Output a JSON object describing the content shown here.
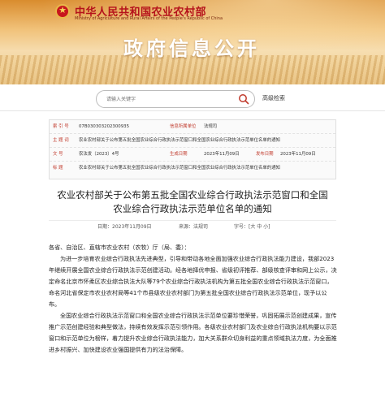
{
  "header": {
    "ministry_cn": "中华人民共和国农业农村部",
    "ministry_en": "Ministry of Agriculture and Rural Affairs of the People's Republic of China",
    "banner_title": "政府信息公开"
  },
  "search": {
    "placeholder": "请输入关键字",
    "advanced_label": "高级检索"
  },
  "meta": {
    "index_label": "索 引 号",
    "index_value": "07B030303202300935",
    "category_label": "信息所属单位",
    "category_value": "法规司",
    "subject_label": "主 题 词",
    "subject_value": "农业农村部关于公布第五批全国农业综合行政执法示范窗口和全国农业综合行政执法示范单位名单的通知",
    "docno_label": "文 号",
    "docno_value": "农法发〔2023〕4号",
    "created_label": "生成日期",
    "created_value": "2023年11月09日",
    "published_label": "发布日期",
    "published_value": "2023年11月09日",
    "title_label": "标 题",
    "title_value": "农业农村部关于公布第五批全国农业综合行政执法示范窗口和全国农业综合行政执法示范单位名单的通知"
  },
  "notice": {
    "title_line1": "农业农村部关于公布第五批全国农业综合行政执法示范窗口和全国",
    "title_line2": "农业综合行政执法示范单位名单的通知",
    "date": "日期：2023年11月09日",
    "source": "来源：法规司",
    "fontsize": "字号：[大 中 小]"
  },
  "body": {
    "greeting": "各省、自治区、直辖市农业农村（农牧）厅（局、委）：",
    "p1": "为进一步培育农业综合行政执法先进典型，引导和带动各地全面加强农业综合行政执法能力建设，我部2023年继续开展全国农业综合行政执法示范创建活动。经各地择优申报、省级初评推荐、部级核查评审和网上公示，决定命名北京市怀柔区农业综合执法大队等79个农业综合行政执法机构为第五批全国农业综合行政执法示范窗口，命名河北省保定市农业农村局等41个市县级农业农村部门为第五批全国农业综合行政执法示范单位，现予以公布。",
    "p2": "全国农业综合行政执法示范窗口和全国农业综合行政执法示范单位要珍惜荣誉，巩固拓展示范创建成果，宣传推广示范创建经验和典型做法，持续有效发挥示范引领作用。各级农业农村部门及农业综合行政执法机构要以示范窗口和示范单位为榜样，着力提升农业综合行政执法能力，加大关系群众切身利益的重点领域执法力度，为全面推进乡村振兴、加快建设农业强国提供有力的法治保障。"
  }
}
